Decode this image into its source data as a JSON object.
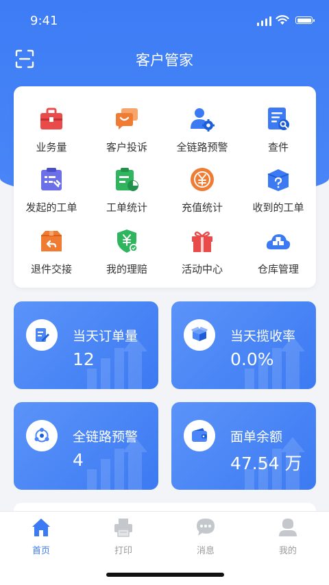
{
  "status_bar": {
    "time": "9:41"
  },
  "header": {
    "title": "客户管家",
    "scan_icon": "scan-icon"
  },
  "menu": {
    "items": [
      {
        "label": "业务量",
        "icon": "briefcase-icon",
        "color": "#e94b4b"
      },
      {
        "label": "客户投诉",
        "icon": "complaint-chat-icon",
        "color": "#f07c33"
      },
      {
        "label": "全链路预警",
        "icon": "user-gear-icon",
        "color": "#3c7af3"
      },
      {
        "label": "查件",
        "icon": "document-search-icon",
        "color": "#3c7af3"
      },
      {
        "label": "发起的工单",
        "icon": "clipboard-tool-icon",
        "color": "#6b6fe8"
      },
      {
        "label": "工单统计",
        "icon": "clipboard-chart-icon",
        "color": "#2fb55d"
      },
      {
        "label": "充值统计",
        "icon": "yuan-coin-icon",
        "color": "#f07c33"
      },
      {
        "label": "收到的工单",
        "icon": "box-question-icon",
        "color": "#3c7af3"
      },
      {
        "label": "退件交接",
        "icon": "box-return-icon",
        "color": "#f07c33"
      },
      {
        "label": "我的理赔",
        "icon": "shield-yuan-icon",
        "color": "#2fb55d"
      },
      {
        "label": "活动中心",
        "icon": "gift-icon",
        "color": "#e94b4b"
      },
      {
        "label": "仓库管理",
        "icon": "warehouse-cloud-icon",
        "color": "#3c7af3"
      }
    ]
  },
  "stats": [
    {
      "name": "当天订单量",
      "value": "12",
      "icon": "order-edit-icon"
    },
    {
      "name": "当天揽收率",
      "value": "0.0%",
      "icon": "package-open-icon"
    },
    {
      "name": "全链路预警",
      "value": "4",
      "icon": "network-icon"
    },
    {
      "name": "面单余额",
      "value": "47.54 万",
      "icon": "wallet-icon"
    }
  ],
  "tabbar": {
    "items": [
      {
        "label": "首页",
        "icon": "home-icon",
        "active": true
      },
      {
        "label": "打印",
        "icon": "printer-icon",
        "active": false
      },
      {
        "label": "消息",
        "icon": "message-icon",
        "active": false
      },
      {
        "label": "我的",
        "icon": "profile-icon",
        "active": false
      }
    ]
  },
  "colors": {
    "accent": "#3c7af3",
    "inactive": "#999999"
  }
}
